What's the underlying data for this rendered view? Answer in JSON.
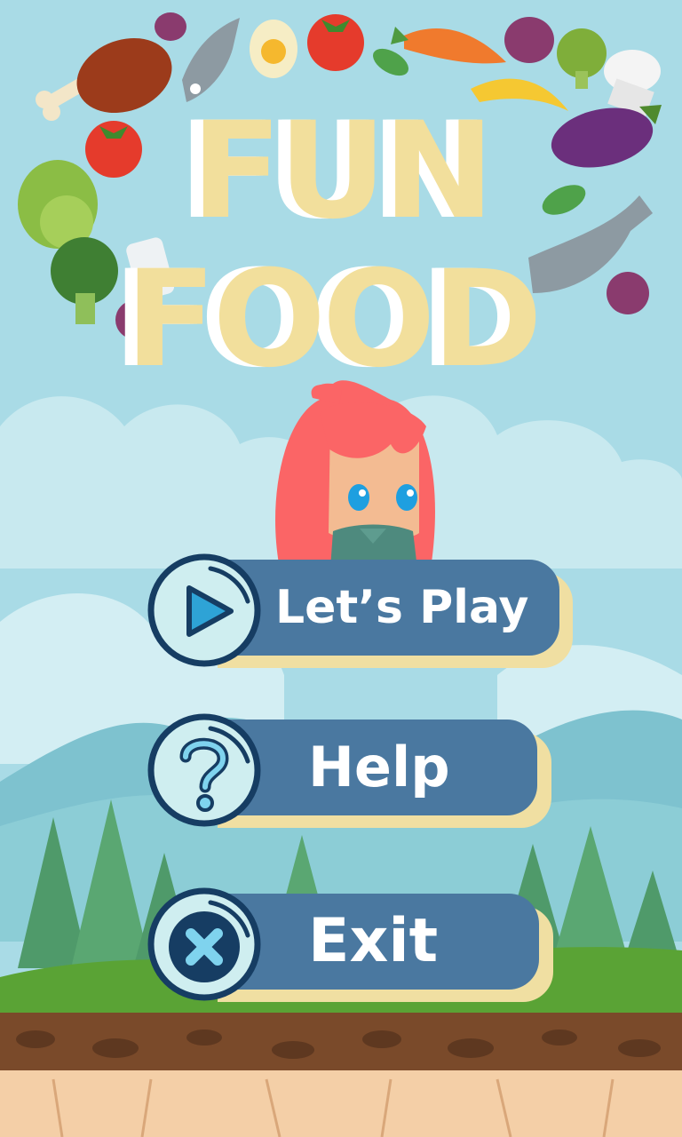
{
  "title": {
    "line1": "FUN",
    "line2": "FOOD"
  },
  "menu": {
    "play": {
      "label": "Let’s Play",
      "icon": "play-icon"
    },
    "help": {
      "label": "Help",
      "icon": "question-icon"
    },
    "exit": {
      "label": "Exit",
      "icon": "close-icon"
    }
  },
  "colors": {
    "sky": "#a9dbe6",
    "button": "#4a78a0",
    "button_shadow": "#f0dfa2",
    "icon_circle": "#cfeef0",
    "icon_stroke": "#163d63",
    "title": "#f2df9c",
    "hair": "#fb6566",
    "grass": "#5aa335",
    "dirt": "#7a4a2a",
    "rock": "#f4cfa7"
  }
}
